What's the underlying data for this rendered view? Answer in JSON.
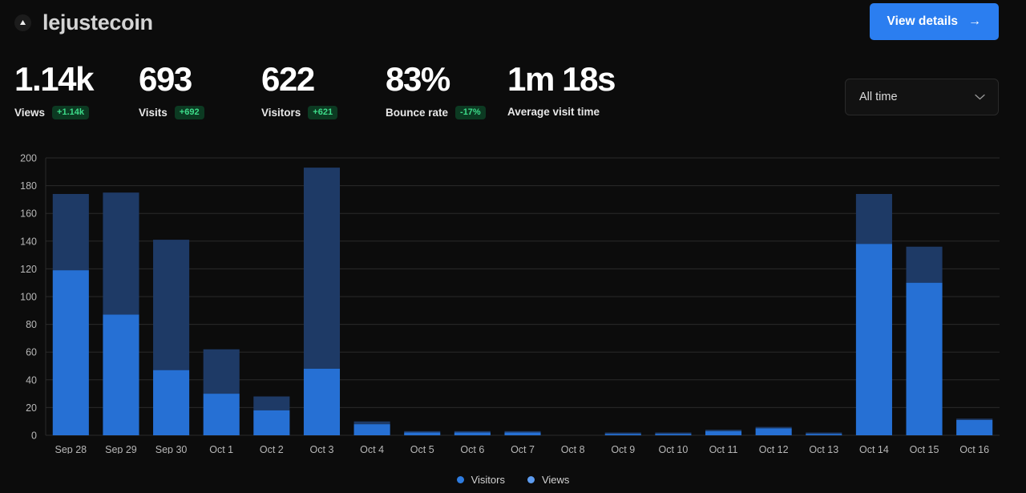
{
  "header": {
    "brand_icon": "triangle-up-icon",
    "title": "lejustecoin",
    "view_details_label": "View details",
    "view_details_arrow": "→",
    "accent_color": "#2b7ef0"
  },
  "stats": [
    {
      "value": "1.14k",
      "label": "Views",
      "badge": "+1.14k",
      "badge_dir": "up",
      "width_class": "w0"
    },
    {
      "value": "693",
      "label": "Visits",
      "badge": "+692",
      "badge_dir": "up",
      "width_class": "w1"
    },
    {
      "value": "622",
      "label": "Visitors",
      "badge": "+621",
      "badge_dir": "up",
      "width_class": "w2"
    },
    {
      "value": "83%",
      "label": "Bounce rate",
      "badge": "-17%",
      "badge_dir": "down",
      "width_class": "w3"
    },
    {
      "value": "1m 18s",
      "label": "Average visit time",
      "badge": "",
      "badge_dir": "",
      "width_class": "w4"
    }
  ],
  "range_selector": {
    "selected": "All time",
    "chevron_icon": "chevron-down-icon"
  },
  "chart_data": {
    "type": "bar",
    "stacked": true,
    "title": "",
    "xlabel": "",
    "ylabel": "",
    "ylim": [
      0,
      200
    ],
    "yticks": [
      0,
      20,
      40,
      60,
      80,
      100,
      120,
      140,
      160,
      180,
      200
    ],
    "grid": true,
    "legend_position": "bottom",
    "categories": [
      "Sep 28",
      "Sep 29",
      "Sep 30",
      "Oct 1",
      "Oct 2",
      "Oct 3",
      "Oct 4",
      "Oct 5",
      "Oct 6",
      "Oct 7",
      "Oct 8",
      "Oct 9",
      "Oct 10",
      "Oct 11",
      "Oct 12",
      "Oct 13",
      "Oct 14",
      "Oct 15",
      "Oct 16"
    ],
    "series": [
      {
        "name": "Visitors",
        "color": "#2670d4",
        "values": [
          119,
          87,
          47,
          30,
          18,
          48,
          8,
          2,
          2,
          2,
          0,
          1,
          1,
          3,
          5,
          1,
          138,
          110,
          11
        ]
      },
      {
        "name": "Views",
        "color": "#1e3a66",
        "values": [
          174,
          175,
          141,
          62,
          28,
          193,
          10,
          3,
          3,
          3,
          0,
          2,
          2,
          4,
          6,
          2,
          174,
          136,
          12
        ]
      }
    ]
  },
  "legend": [
    {
      "name": "Visitors",
      "color": "#2e7ce0"
    },
    {
      "name": "Views",
      "color": "#5d9cf0"
    }
  ],
  "colors": {
    "background": "#0c0c0c",
    "grid": "#2a2a2a",
    "axis_text": "#b8b8b8"
  }
}
